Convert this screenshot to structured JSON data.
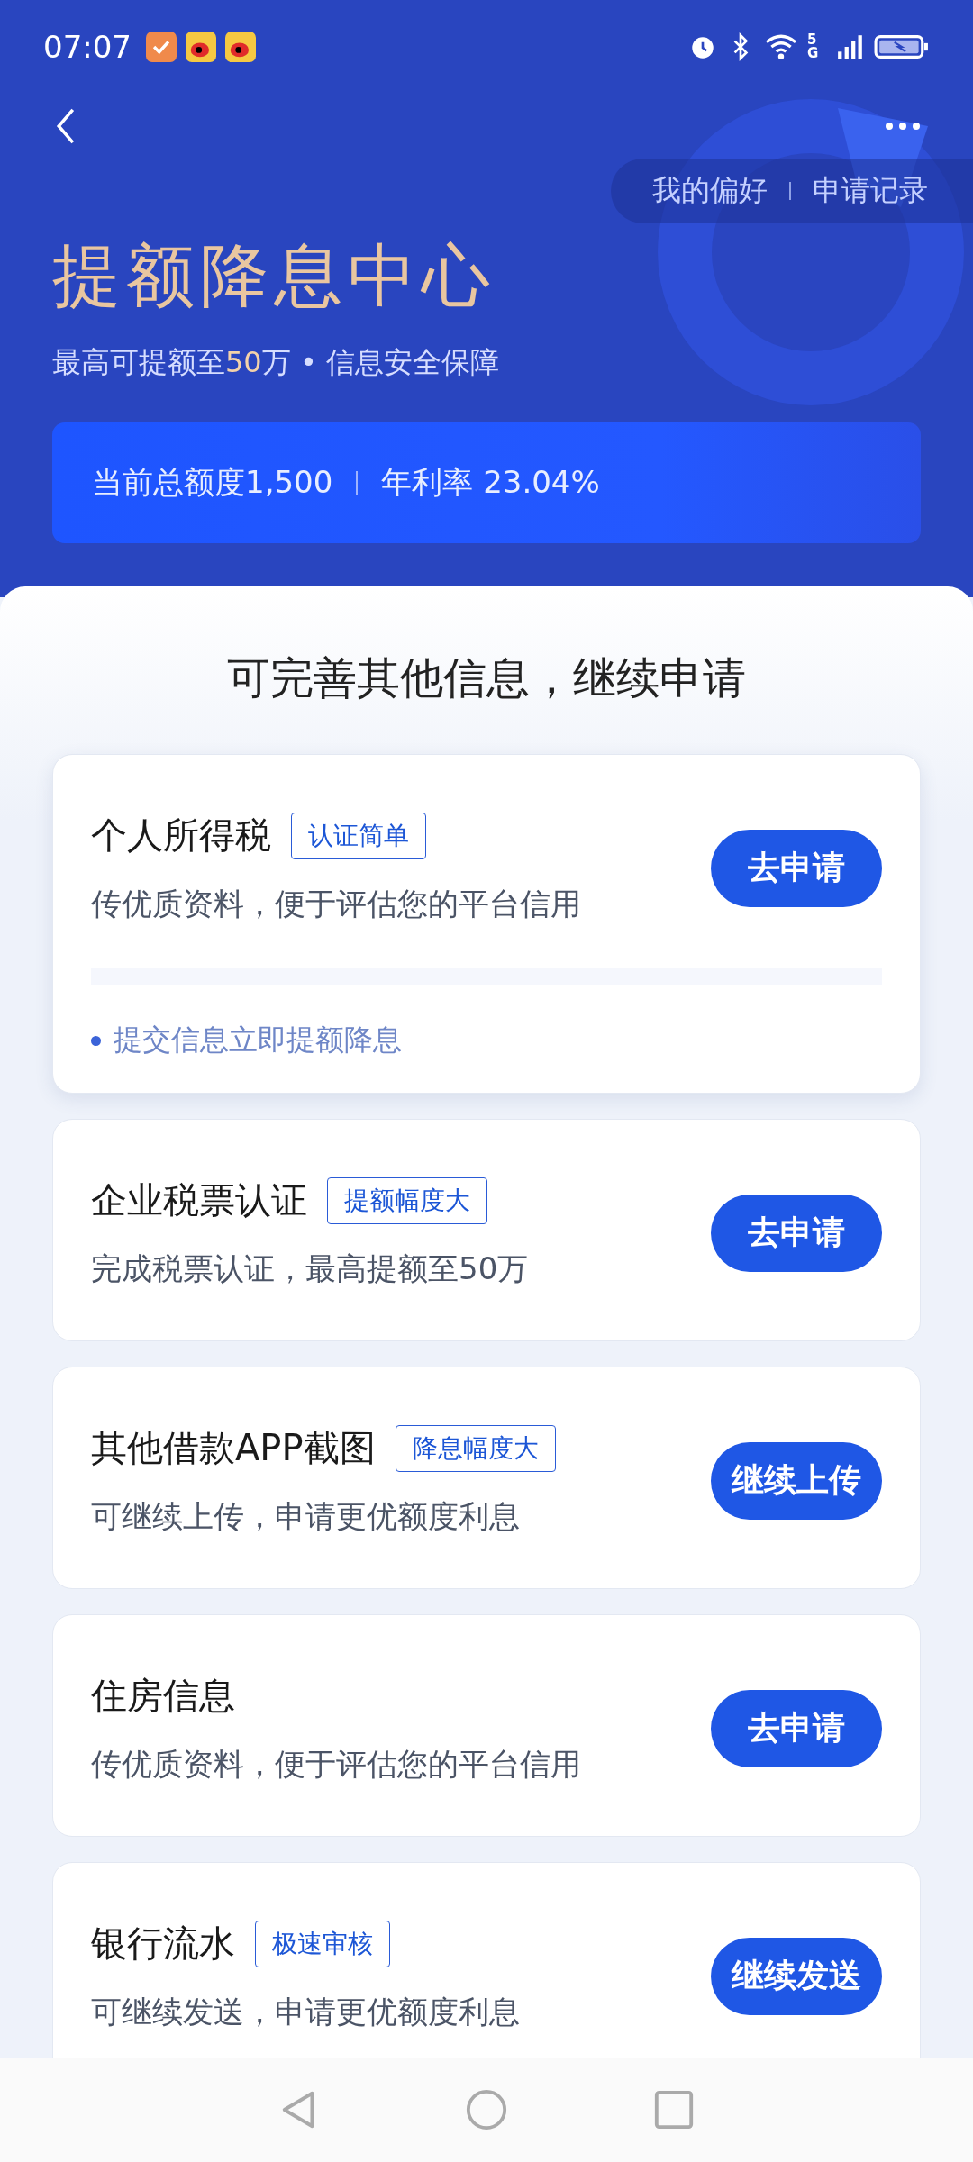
{
  "status_bar": {
    "time": "07:07",
    "network": "5G"
  },
  "header": {
    "links": [
      "我的偏好",
      "申请记录"
    ],
    "title": "提额降息中心",
    "subtitle": "最高可提额至**50**万 • 信息安全保障"
  },
  "quota": {
    "amount": "当前总额度1,500",
    "rate": "年利率 23.04%"
  },
  "section_title": "可完善其他信息，继续申请",
  "cards": [
    {
      "title": "个人所得税",
      "tag": "认证简单",
      "description": "传优质资料，便于评估您的平台信用",
      "button": "去申请",
      "note": "提交信息立即提额降息"
    },
    {
      "title": "企业税票认证",
      "tag": "提额幅度大",
      "description": "完成税票认证，最高提额至50万",
      "button": "去申请"
    },
    {
      "title": "其他借款APP截图",
      "tag": "降息幅度大",
      "description": "可继续上传，申请更优额度利息",
      "button": "继续上传"
    },
    {
      "title": "住房信息",
      "description": "传优质资料，便于评估您的平台信用",
      "button": "去申请"
    },
    {
      "title": "银行流水",
      "tag": "极速审核",
      "description": "可继续发送，申请更优额度利息",
      "button": "继续发送"
    }
  ]
}
